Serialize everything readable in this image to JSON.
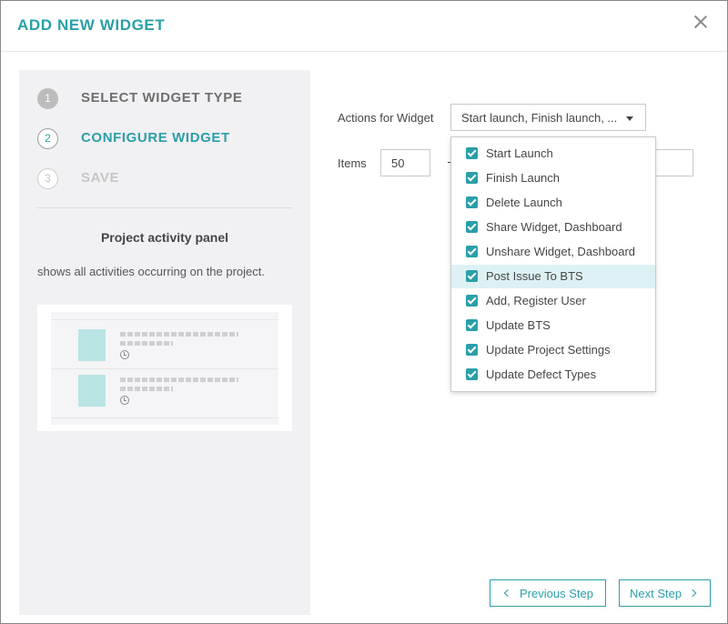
{
  "modal": {
    "title": "ADD NEW WIDGET"
  },
  "wizard": {
    "steps": [
      {
        "number": "1",
        "label": "SELECT WIDGET TYPE",
        "state": "completed"
      },
      {
        "number": "2",
        "label": "CONFIGURE WIDGET",
        "state": "active"
      },
      {
        "number": "3",
        "label": "SAVE",
        "state": "pending"
      }
    ],
    "widget_name": "Project activity panel",
    "widget_description": "shows all activities occurring on the project."
  },
  "config": {
    "actions_label": "Actions for Widget",
    "actions_value": "Start launch, Finish launch, ...",
    "items_label": "Items",
    "items_value": "50"
  },
  "dropdown": {
    "options": [
      {
        "label": "Start Launch",
        "checked": true
      },
      {
        "label": "Finish Launch",
        "checked": true
      },
      {
        "label": "Delete Launch",
        "checked": true
      },
      {
        "label": "Share Widget, Dashboard",
        "checked": true
      },
      {
        "label": "Unshare Widget, Dashboard",
        "checked": true
      },
      {
        "label": "Post Issue To BTS",
        "checked": true,
        "highlighted": true
      },
      {
        "label": "Add, Register User",
        "checked": true
      },
      {
        "label": "Update BTS",
        "checked": true
      },
      {
        "label": "Update Project Settings",
        "checked": true
      },
      {
        "label": "Update Defect Types",
        "checked": true
      }
    ]
  },
  "footer": {
    "prev_label": "Previous Step",
    "next_label": "Next Step"
  },
  "colors": {
    "accent": "#2a9fa8",
    "highlight": "#ddf1f4",
    "panel": "#f1f0f3"
  }
}
